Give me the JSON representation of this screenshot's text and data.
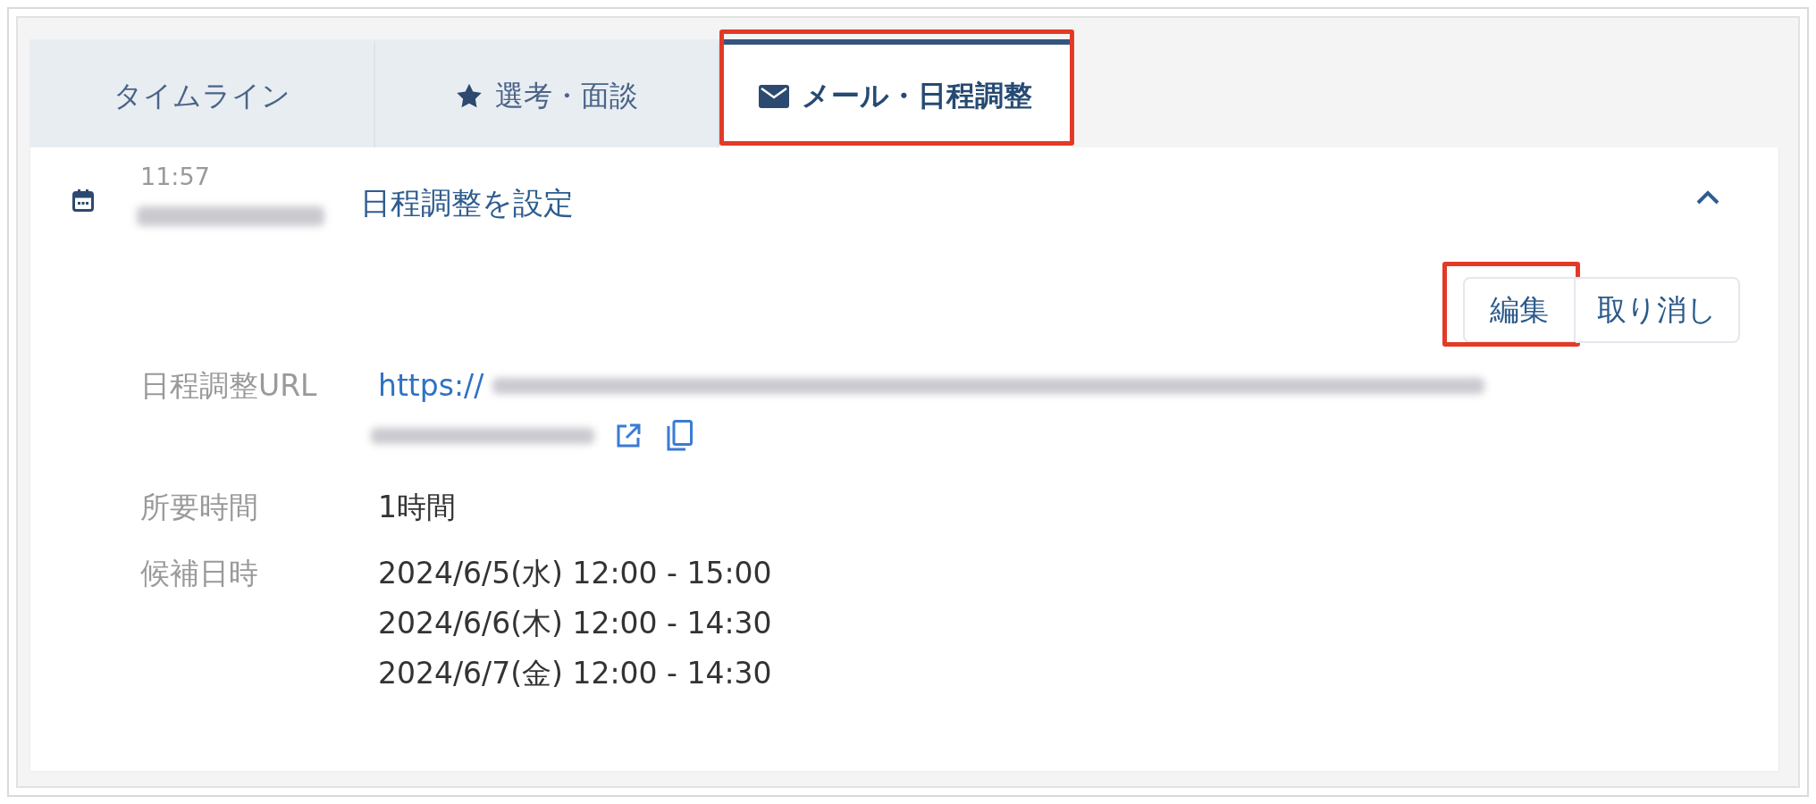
{
  "tabs": [
    {
      "label": "タイムライン",
      "kind": "plain",
      "selected": false,
      "highlighted": false
    },
    {
      "label": "選考・面談",
      "kind": "star",
      "selected": false,
      "highlighted": false
    },
    {
      "label": "メール・日程調整",
      "kind": "mail",
      "selected": true,
      "highlighted": true
    }
  ],
  "event": {
    "time": "11:57",
    "title": "日程調整を設定",
    "expanded": true,
    "actions": [
      {
        "label": "編集",
        "highlighted": true
      },
      {
        "label": "取り消し",
        "highlighted": false
      }
    ],
    "details": [
      {
        "label": "日程調整URL",
        "kind": "link",
        "link": "https://"
      },
      {
        "label": "所要時間",
        "kind": "text",
        "lines": [
          "1時間"
        ]
      },
      {
        "label": "候補日時",
        "kind": "text",
        "lines": [
          "2024/6/5(水) 12:00 - 15:00",
          "2024/6/6(木) 12:00 - 14:30",
          "2024/6/7(金) 12:00 - 14:30"
        ]
      }
    ]
  }
}
